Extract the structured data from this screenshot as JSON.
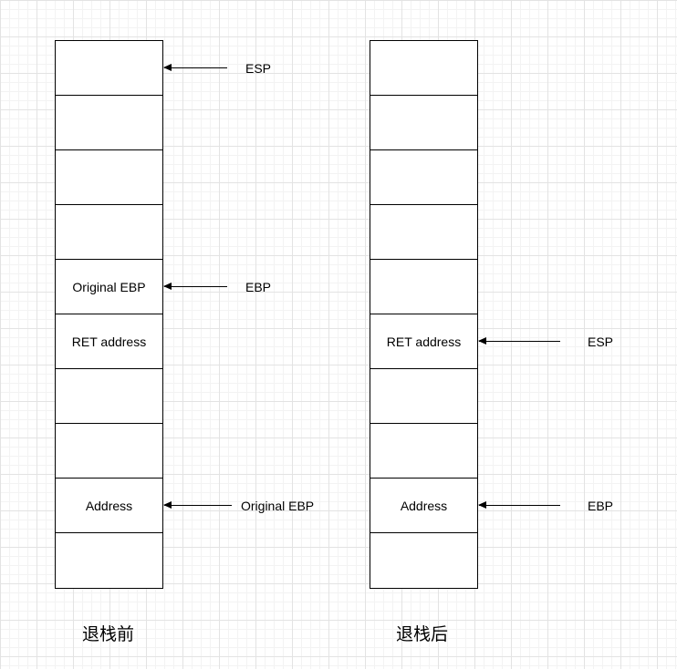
{
  "before": {
    "caption": "退栈前",
    "cells": [
      "",
      "",
      "",
      "",
      "Original EBP",
      "RET address",
      "",
      "",
      "Address",
      ""
    ],
    "pointers": {
      "esp": "ESP",
      "ebp": "EBP",
      "original_ebp": "Original EBP"
    }
  },
  "after": {
    "caption": "退栈后",
    "cells": [
      "",
      "",
      "",
      "",
      "",
      "RET address",
      "",
      "",
      "Address",
      ""
    ],
    "pointers": {
      "esp": "ESP",
      "ebp": "EBP"
    }
  }
}
